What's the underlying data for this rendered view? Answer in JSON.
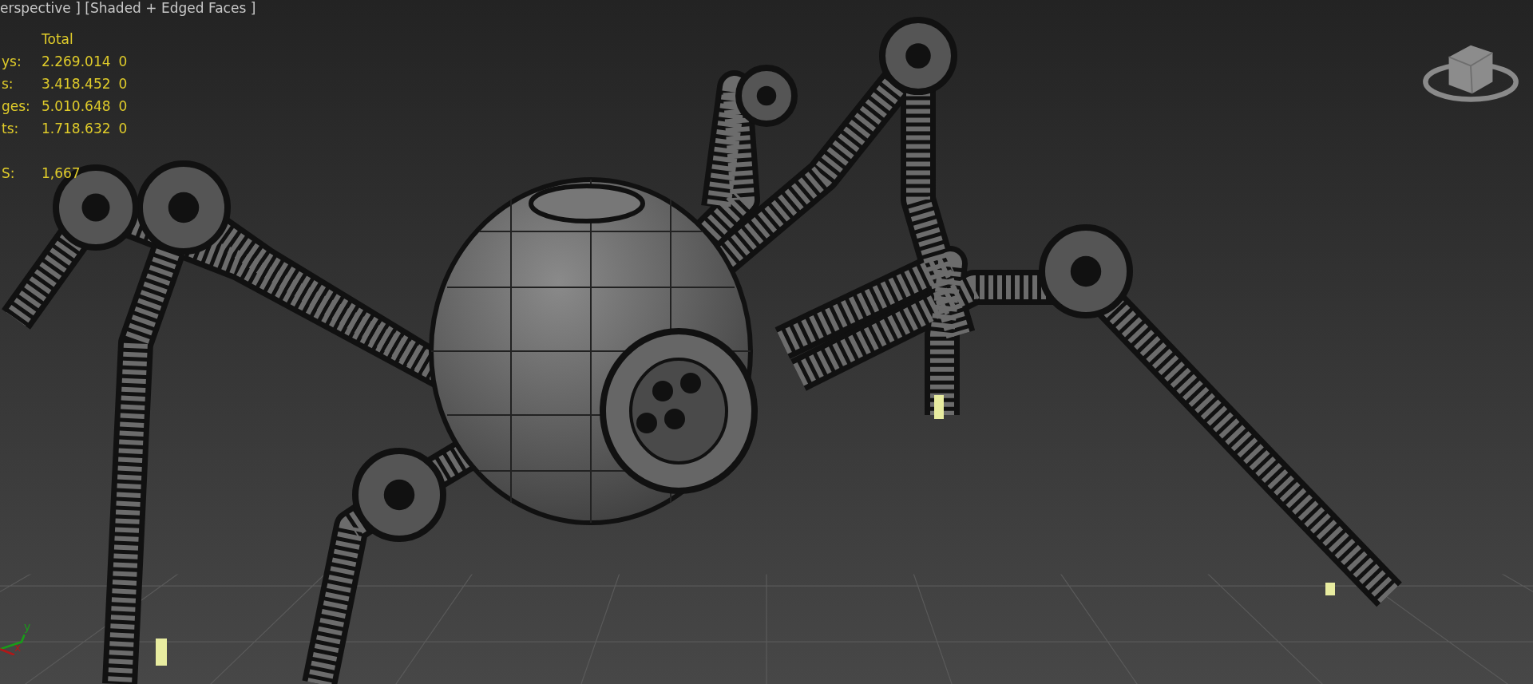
{
  "viewport": {
    "label": "erspective ] [Shaded + Edged Faces ]"
  },
  "statistics": {
    "header": "Total",
    "rows": [
      {
        "label": "ys:",
        "total": "2.269.014",
        "selection": "0"
      },
      {
        "label": "s:",
        "total": "3.418.452",
        "selection": "0"
      },
      {
        "label": "ges:",
        "total": "5.010.648",
        "selection": "0"
      },
      {
        "label": "ts:",
        "total": "1.718.632",
        "selection": "0"
      }
    ],
    "fps": {
      "label": "S:",
      "value": "1,667"
    }
  },
  "axis_gizmo": {
    "y_label": "y",
    "x_label": "x"
  }
}
